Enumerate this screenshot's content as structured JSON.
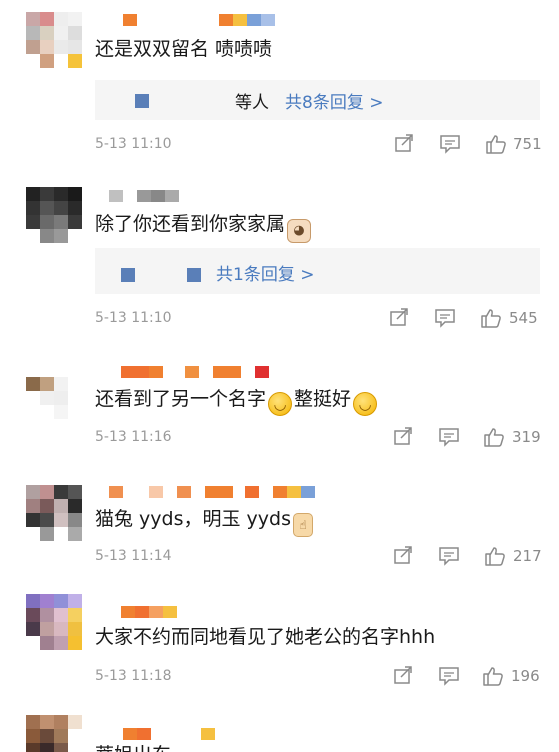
{
  "comments": [
    {
      "text": "还是双双留名 啧啧啧",
      "reply_who": "等人",
      "reply_link": "共8条回复 >",
      "time": "5-13 11:10",
      "likes": "751"
    },
    {
      "text": "除了你还看到你家家属",
      "reply_who": "",
      "reply_link": "共1条回复 >",
      "time": "5-13 11:10",
      "likes": "545"
    },
    {
      "text": "还看到了另一个名字",
      "text2": "整挺好",
      "time": "5-13 11:16",
      "likes": "319"
    },
    {
      "text": "猫兔 yyds，明玉 yyds",
      "time": "5-13 11:14",
      "likes": "217"
    },
    {
      "text": "大家不约而同地看见了她老公的名字hhh",
      "time": "5-13 11:18",
      "likes": "196"
    },
    {
      "text": "蒂姐出东"
    }
  ],
  "icons": {
    "share": "share-icon",
    "comment": "comment-icon",
    "like": "thumbs-up-icon",
    "smile": "smile-emoji-icon",
    "cat": "cat-emoji-icon",
    "thumb": "thumbs-up-emoji-icon"
  },
  "colors": {
    "link": "#4a7bbf",
    "meta": "#9a9a9a",
    "reply_bg": "#f5f5f5"
  }
}
